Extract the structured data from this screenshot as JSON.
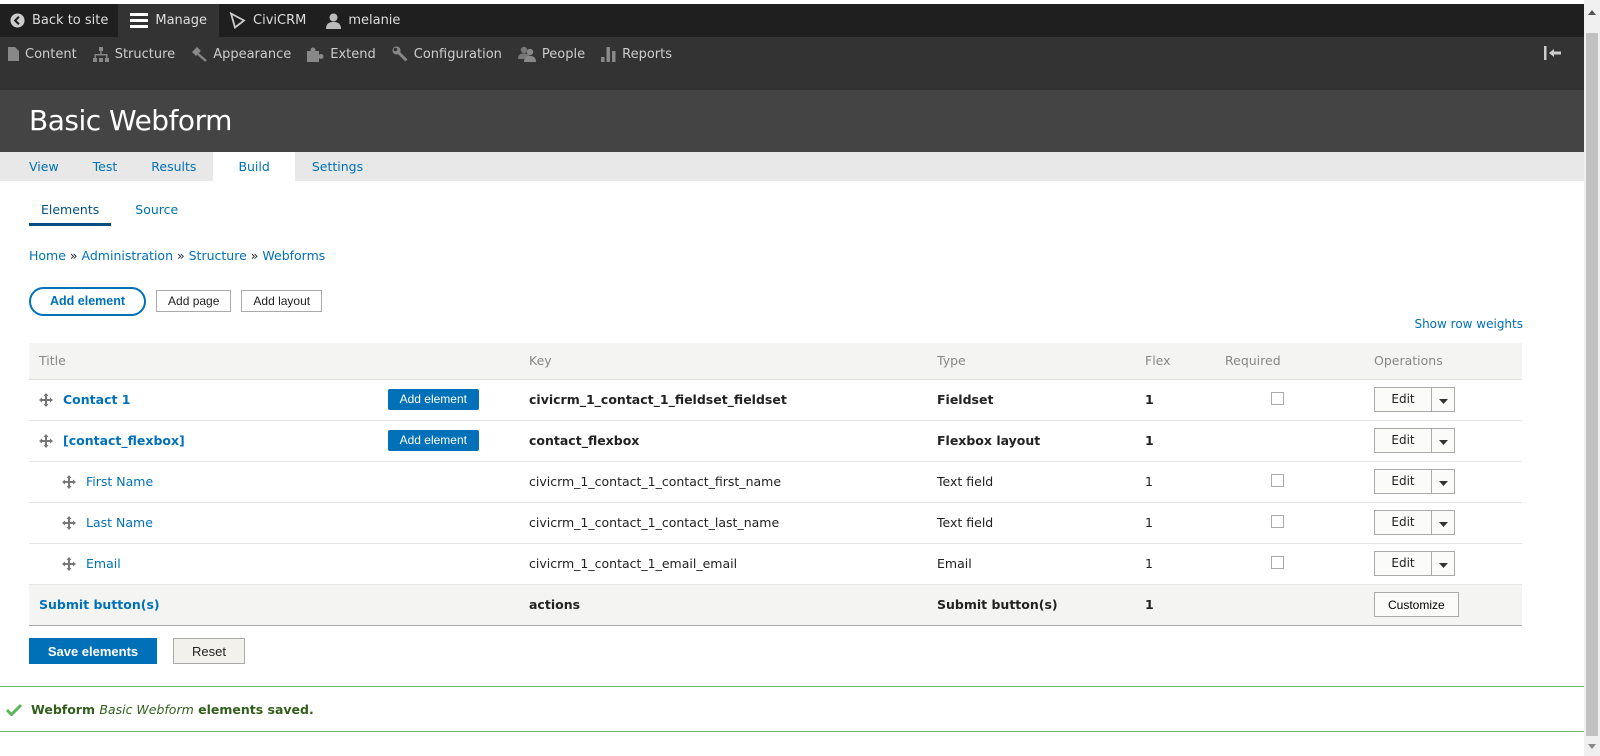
{
  "toolbar": {
    "back_to_site": "Back to site",
    "manage": "Manage",
    "civicrm": "CiviCRM",
    "user": "melanie"
  },
  "tray": {
    "items": [
      {
        "label": "Content",
        "icon": "file-icon"
      },
      {
        "label": "Structure",
        "icon": "sitemap-icon"
      },
      {
        "label": "Appearance",
        "icon": "brush-icon"
      },
      {
        "label": "Extend",
        "icon": "puzzle-icon"
      },
      {
        "label": "Configuration",
        "icon": "wrench-icon"
      },
      {
        "label": "People",
        "icon": "people-icon"
      },
      {
        "label": "Reports",
        "icon": "bar-chart-icon"
      }
    ]
  },
  "page": {
    "title": "Basic Webform"
  },
  "primary_tabs": [
    {
      "label": "View",
      "active": false
    },
    {
      "label": "Test",
      "active": false
    },
    {
      "label": "Results",
      "active": false
    },
    {
      "label": "Build",
      "active": true
    },
    {
      "label": "Settings",
      "active": false
    }
  ],
  "secondary_tabs": [
    {
      "label": "Elements",
      "active": true
    },
    {
      "label": "Source",
      "active": false
    }
  ],
  "breadcrumb": {
    "items": [
      "Home",
      "Administration",
      "Structure",
      "Webforms"
    ],
    "separator": "»"
  },
  "actions": {
    "add_element": "Add element",
    "add_page": "Add page",
    "add_layout": "Add layout",
    "show_row_weights": "Show row weights"
  },
  "table": {
    "headers": {
      "title": "Title",
      "key": "Key",
      "type": "Type",
      "flex": "Flex",
      "required": "Required",
      "operations": "Operations"
    },
    "add_element_label": "Add element",
    "edit_label": "Edit",
    "rows": [
      {
        "title": "Contact 1",
        "key": "civicrm_1_contact_1_fieldset_fieldset",
        "type": "Fieldset",
        "flex": "1",
        "required": false
      },
      {
        "title": "[contact_flexbox]",
        "key": "contact_flexbox",
        "type": "Flexbox layout",
        "flex": "1"
      },
      {
        "title": "First Name",
        "key": "civicrm_1_contact_1_contact_first_name",
        "type": "Text field",
        "flex": "1",
        "required": false
      },
      {
        "title": "Last Name",
        "key": "civicrm_1_contact_1_contact_last_name",
        "type": "Text field",
        "flex": "1",
        "required": false
      },
      {
        "title": "Email",
        "key": "civicrm_1_contact_1_email_email",
        "type": "Email",
        "flex": "1",
        "required": false
      }
    ],
    "submit_row": {
      "title": "Submit button(s)",
      "key": "actions",
      "type": "Submit button(s)",
      "flex": "1",
      "operation": "Customize"
    }
  },
  "form_actions": {
    "save": "Save elements",
    "reset": "Reset"
  },
  "message": {
    "prefix": "Webform",
    "name": "Basic Webform",
    "suffix": "elements saved."
  },
  "colors": {
    "accent": "#0071b8",
    "toolbar_bg": "#1f1f1f",
    "tray_bg": "#333333",
    "header_bg": "#444444",
    "success": "#6bb56b"
  }
}
